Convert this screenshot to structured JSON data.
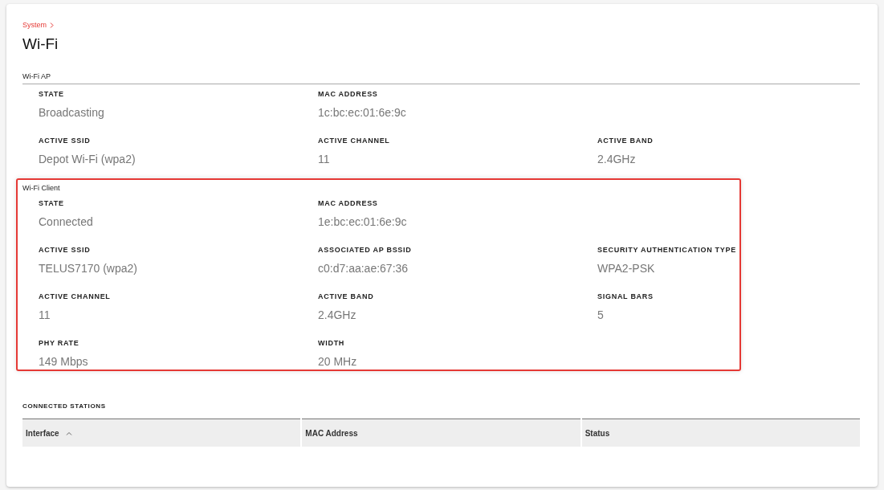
{
  "breadcrumb": "System",
  "title": "Wi-Fi",
  "sections": [
    {
      "title": "Wi-Fi AP",
      "highlighted": false,
      "rows": [
        [
          {
            "label": "STATE",
            "value": "Broadcasting"
          },
          {
            "label": "MAC ADDRESS",
            "value": "1c:bc:ec:01:6e:9c"
          }
        ],
        [
          {
            "label": "ACTIVE SSID",
            "value": "Depot Wi-Fi (wpa2)"
          },
          {
            "label": "ACTIVE CHANNEL",
            "value": "11"
          },
          {
            "label": "ACTIVE BAND",
            "value": "2.4GHz"
          }
        ]
      ]
    },
    {
      "title": "Wi-Fi Client",
      "highlighted": true,
      "rows": [
        [
          {
            "label": "STATE",
            "value": "Connected"
          },
          {
            "label": "MAC ADDRESS",
            "value": "1e:bc:ec:01:6e:9c"
          }
        ],
        [
          {
            "label": "ACTIVE SSID",
            "value": "TELUS7170 (wpa2)"
          },
          {
            "label": "ASSOCIATED AP BSSID",
            "value": "c0:d7:aa:ae:67:36"
          },
          {
            "label": "SECURITY AUTHENTICATION TYPE",
            "value": "WPA2-PSK"
          }
        ],
        [
          {
            "label": "ACTIVE CHANNEL",
            "value": "11"
          },
          {
            "label": "ACTIVE BAND",
            "value": "2.4GHz"
          },
          {
            "label": "SIGNAL BARS",
            "value": "5"
          }
        ],
        [
          {
            "label": "PHY RATE",
            "value": "149 Mbps"
          },
          {
            "label": "WIDTH",
            "value": "20 MHz"
          }
        ]
      ]
    }
  ],
  "stations": {
    "title": "CONNECTED STATIONS",
    "columns": [
      {
        "label": "Interface",
        "sorted": true
      },
      {
        "label": "MAC Address",
        "sorted": false
      },
      {
        "label": "Status",
        "sorted": false
      }
    ]
  }
}
